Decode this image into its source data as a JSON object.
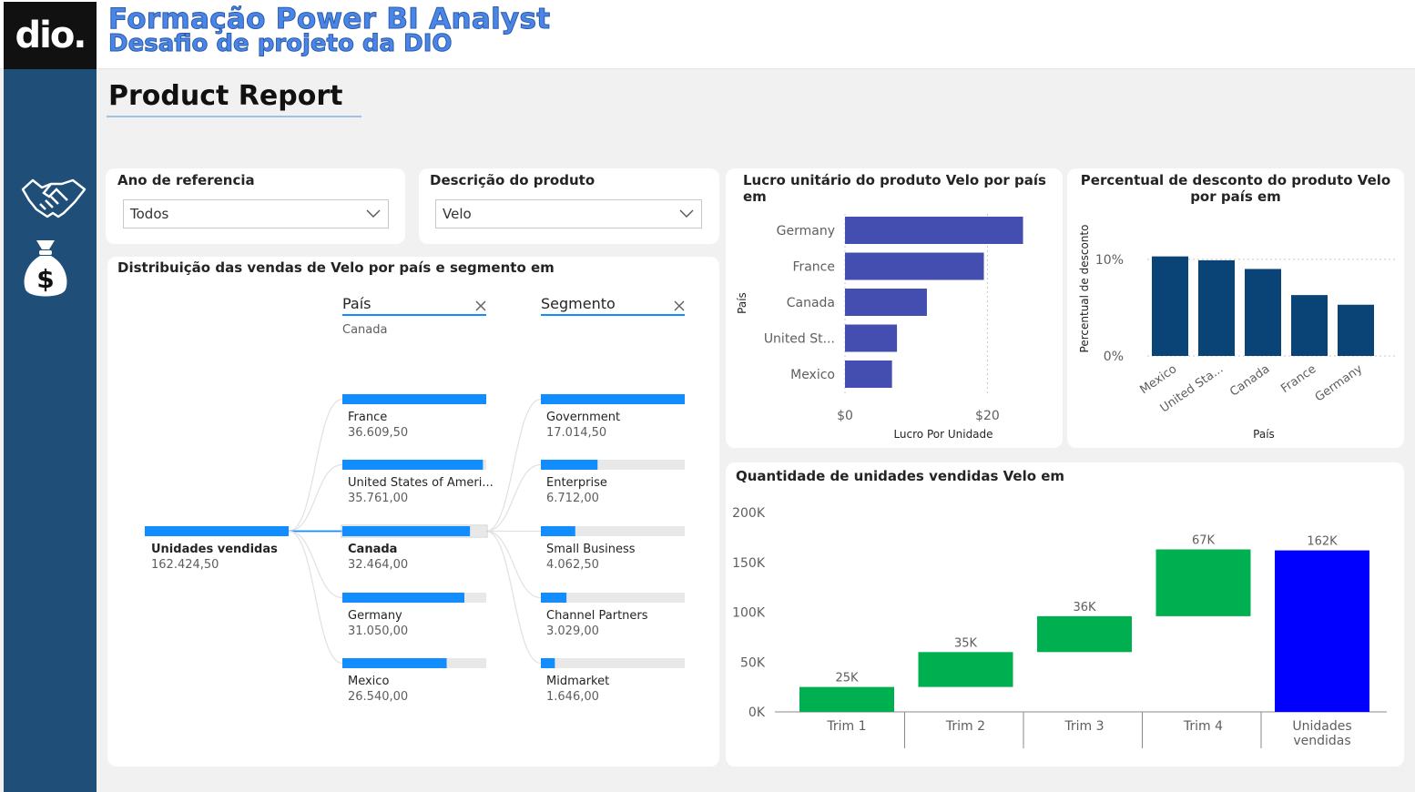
{
  "header": {
    "logo_text": "dio.",
    "title_line1": "Formação Power BI Analyst",
    "title_line2": "Desafio de projeto da DIO",
    "report_title": "Product Report"
  },
  "sidebar": {
    "icons": [
      "handshake-icon",
      "money-bag-icon"
    ]
  },
  "filters": {
    "year": {
      "label": "Ano de referencia",
      "value": "Todos"
    },
    "product": {
      "label": "Descrição do produto",
      "value": "Velo"
    }
  },
  "decomposition": {
    "title": "Distribuição das vendas de Velo por país e segmento em",
    "root": {
      "label": "Unidades vendidas",
      "value": "162.424,50"
    },
    "level1": {
      "header": "País",
      "selected": "Canada",
      "items": [
        {
          "label": "France",
          "value": "36.609,50",
          "fill": 1.0
        },
        {
          "label": "United States of Ameri...",
          "value": "35.761,00",
          "fill": 0.977
        },
        {
          "label": "Canada",
          "value": "32.464,00",
          "fill": 0.887
        },
        {
          "label": "Germany",
          "value": "31.050,00",
          "fill": 0.848
        },
        {
          "label": "Mexico",
          "value": "26.540,00",
          "fill": 0.725
        }
      ]
    },
    "level2": {
      "header": "Segmento",
      "items": [
        {
          "label": "Government",
          "value": "17.014,50",
          "fill": 1.0
        },
        {
          "label": "Enterprise",
          "value": "6.712,00",
          "fill": 0.394
        },
        {
          "label": "Small Business",
          "value": "4.062,50",
          "fill": 0.239
        },
        {
          "label": "Channel Partners",
          "value": "3.029,00",
          "fill": 0.178
        },
        {
          "label": "Midmarket",
          "value": "1.646,00",
          "fill": 0.097
        }
      ]
    }
  },
  "chart_data": [
    {
      "type": "bar",
      "orientation": "horizontal",
      "title": "Lucro unitário do produto Velo por país em",
      "xlabel": "Lucro Por Unidade",
      "ylabel": "País",
      "categories": [
        "Germany",
        "France",
        "Canada",
        "United St...",
        "Mexico"
      ],
      "values": [
        25,
        19.5,
        11.5,
        7.3,
        6.6
      ],
      "xticks": [
        "$0",
        "$20"
      ],
      "xlim": [
        0,
        28
      ],
      "color": "#444eb0"
    },
    {
      "type": "bar",
      "title": "Percentual de desconto do produto Velo por país em",
      "xlabel": "País",
      "ylabel": "Percentual de desconto",
      "categories": [
        "Mexico",
        "United Sta...",
        "Canada",
        "France",
        "Germany"
      ],
      "values": [
        10.3,
        9.9,
        9.0,
        6.3,
        5.3
      ],
      "yticks": [
        "0%",
        "10%"
      ],
      "ylim": [
        0,
        13
      ],
      "grid": true,
      "color": "#0a4477"
    },
    {
      "type": "waterfall",
      "title": "Quantidade de unidades vendidas Velo em",
      "categories": [
        "Trim 1",
        "Trim 2",
        "Trim 3",
        "Trim 4",
        "Unidades vendidas"
      ],
      "values": [
        25,
        35,
        36,
        67,
        162
      ],
      "labels": [
        "25K",
        "35K",
        "36K",
        "67K",
        "162K"
      ],
      "yticks": [
        "0K",
        "50K",
        "100K",
        "150K",
        "200K"
      ],
      "ylim": [
        0,
        200
      ],
      "colors": {
        "increase": "#00b050",
        "total": "#0000ff"
      }
    }
  ]
}
